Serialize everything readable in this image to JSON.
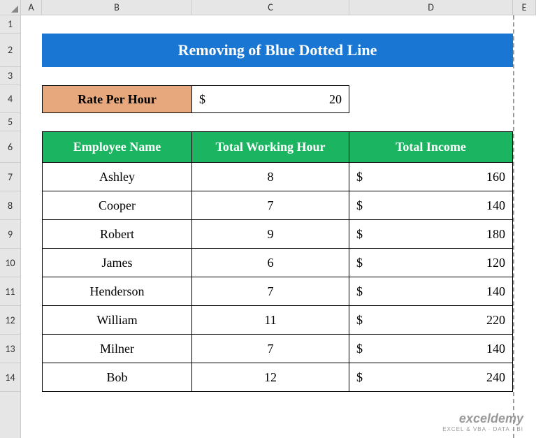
{
  "columns": {
    "A": "A",
    "B": "B",
    "C": "C",
    "D": "D",
    "E": "E"
  },
  "rows": {
    "r1": "1",
    "r2": "2",
    "r3": "3",
    "r4": "4",
    "r5": "5",
    "r6": "6",
    "r7": "7",
    "r8": "8",
    "r9": "9",
    "r10": "10",
    "r11": "11",
    "r12": "12",
    "r13": "13",
    "r14": "14"
  },
  "title": "Removing of Blue Dotted Line",
  "rate": {
    "label": "Rate Per Hour",
    "symbol": "$",
    "value": "20"
  },
  "headers": {
    "name": "Employee Name",
    "hours": "Total Working Hour",
    "income": "Total Income"
  },
  "employees": [
    {
      "name": "Ashley",
      "hours": "8",
      "symbol": "$",
      "income": "160"
    },
    {
      "name": "Cooper",
      "hours": "7",
      "symbol": "$",
      "income": "140"
    },
    {
      "name": "Robert",
      "hours": "9",
      "symbol": "$",
      "income": "180"
    },
    {
      "name": "James",
      "hours": "6",
      "symbol": "$",
      "income": "120"
    },
    {
      "name": "Henderson",
      "hours": "7",
      "symbol": "$",
      "income": "140"
    },
    {
      "name": "William",
      "hours": "11",
      "symbol": "$",
      "income": "220"
    },
    {
      "name": "Milner",
      "hours": "7",
      "symbol": "$",
      "income": "140"
    },
    {
      "name": "Bob",
      "hours": "12",
      "symbol": "$",
      "income": "240"
    }
  ],
  "watermark": {
    "brand": "exceldemy",
    "tag": "EXCEL & VBA · DATA · BI"
  },
  "chart_data": {
    "type": "table",
    "title": "Removing of Blue Dotted Line",
    "rate_per_hour": 20,
    "columns": [
      "Employee Name",
      "Total Working Hour",
      "Total Income"
    ],
    "rows": [
      [
        "Ashley",
        8,
        160
      ],
      [
        "Cooper",
        7,
        140
      ],
      [
        "Robert",
        9,
        180
      ],
      [
        "James",
        6,
        120
      ],
      [
        "Henderson",
        7,
        140
      ],
      [
        "William",
        11,
        220
      ],
      [
        "Milner",
        7,
        140
      ],
      [
        "Bob",
        12,
        240
      ]
    ]
  }
}
